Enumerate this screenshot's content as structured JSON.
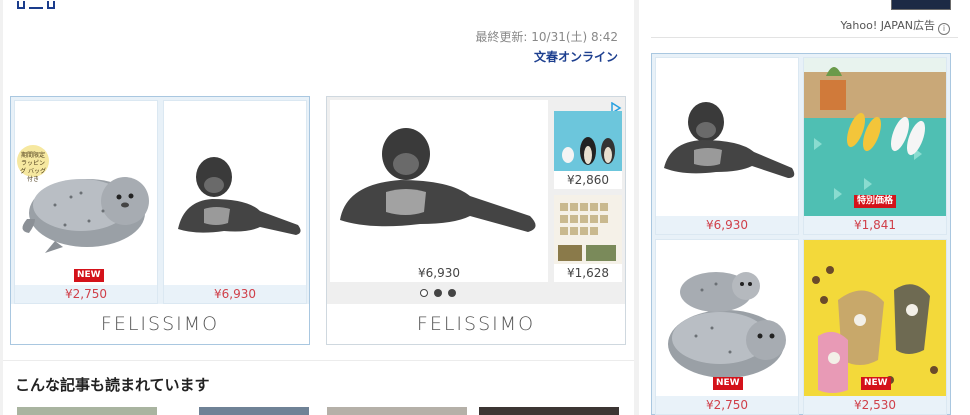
{
  "header": {
    "updated_label": "最終更新: 10/31(土) 8:42",
    "source": "文春オンライン"
  },
  "ad1": {
    "logo": "FELISSIMO",
    "cards": [
      {
        "tag": "期間限定 ラッピング バッグ付き",
        "badge": "NEW",
        "price": "¥2,750",
        "image": "seal-plush"
      },
      {
        "price": "¥6,930",
        "image": "gorilla-figure"
      }
    ]
  },
  "ad2": {
    "logo": "FELISSIMO",
    "main": {
      "price": "¥6,930",
      "image": "gorilla-figure"
    },
    "side": [
      {
        "price": "¥2,860",
        "image": "penguin-figures"
      },
      {
        "price": "¥1,628",
        "image": "animal-cards"
      }
    ]
  },
  "section": {
    "title": "こんな記事も読まれています"
  },
  "sidebar": {
    "ad_label": "Yahoo! JAPAN広告",
    "info_icon": "info-icon",
    "cards": [
      {
        "price": "¥6,930",
        "image": "gorilla-figure"
      },
      {
        "badge": "特別価格",
        "price": "¥1,841",
        "image": "shoes-on-mat"
      },
      {
        "badge": "NEW",
        "price": "¥2,750",
        "image": "seal-plush-stack"
      },
      {
        "badge": "NEW",
        "price": "¥2,530",
        "image": "hamster-bags"
      }
    ]
  },
  "colors": {
    "link": "#1d3f8f",
    "price": "#d0404a",
    "badge": "#d4121a",
    "ad_border": "#a9c7e0"
  }
}
